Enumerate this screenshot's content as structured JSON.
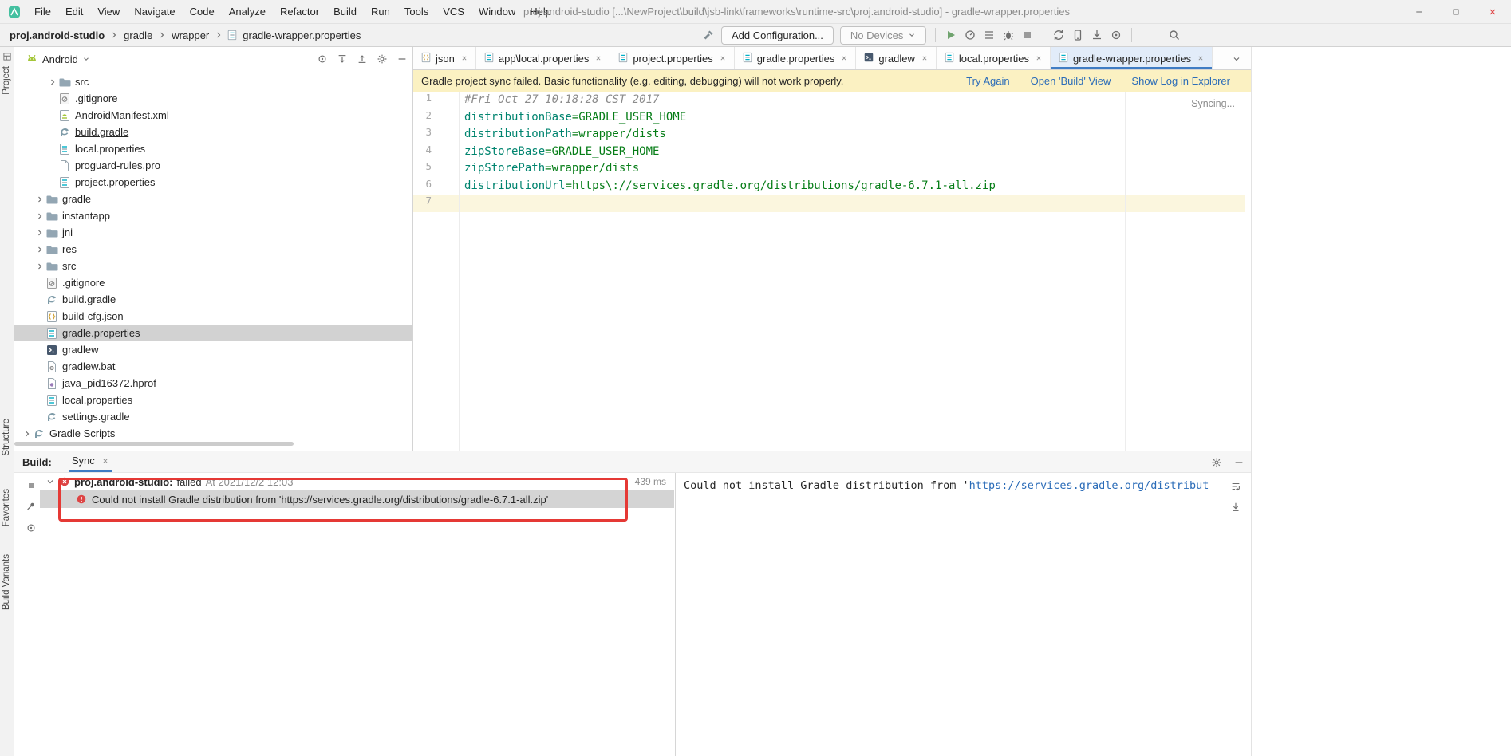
{
  "window": {
    "title": "proj.android-studio [...\\NewProject\\build\\jsb-link\\frameworks\\runtime-src\\proj.android-studio] - gradle-wrapper.properties",
    "menus": [
      "File",
      "Edit",
      "View",
      "Navigate",
      "Code",
      "Analyze",
      "Refactor",
      "Build",
      "Run",
      "Tools",
      "VCS",
      "Window",
      "Help"
    ]
  },
  "toolbar": {
    "breadcrumbs": [
      "proj.android-studio",
      "gradle",
      "wrapper",
      "gradle-wrapper.properties"
    ],
    "add_configuration": "Add Configuration...",
    "device_selector": "No Devices"
  },
  "stripes": {
    "project": "Project",
    "structure": "Structure",
    "favorites": "Favorites",
    "build_variants": "Build Variants"
  },
  "project_panel": {
    "selector": "Android",
    "tree": [
      {
        "label": "src"
      },
      {
        "label": ".gitignore"
      },
      {
        "label": "AndroidManifest.xml"
      },
      {
        "label": "build.gradle"
      },
      {
        "label": "local.properties"
      },
      {
        "label": "proguard-rules.pro"
      },
      {
        "label": "project.properties"
      },
      {
        "label": "gradle"
      },
      {
        "label": "instantapp"
      },
      {
        "label": "jni"
      },
      {
        "label": "res"
      },
      {
        "label": "src"
      },
      {
        "label": ".gitignore"
      },
      {
        "label": "build.gradle"
      },
      {
        "label": "build-cfg.json"
      },
      {
        "label": "gradle.properties"
      },
      {
        "label": "gradlew"
      },
      {
        "label": "gradlew.bat"
      },
      {
        "label": "java_pid16372.hprof"
      },
      {
        "label": "local.properties"
      },
      {
        "label": "settings.gradle"
      },
      {
        "label": "Gradle Scripts"
      }
    ]
  },
  "editor": {
    "tabs": [
      {
        "label": "json"
      },
      {
        "label": "app\\local.properties"
      },
      {
        "label": "project.properties"
      },
      {
        "label": "gradle.properties"
      },
      {
        "label": "gradlew"
      },
      {
        "label": "local.properties"
      },
      {
        "label": "gradle-wrapper.properties"
      }
    ],
    "banner": {
      "message": "Gradle project sync failed. Basic functionality (e.g. editing, debugging) will not work properly.",
      "actions": [
        "Try Again",
        "Open 'Build' View",
        "Show Log in Explorer"
      ]
    },
    "syncing": "Syncing...",
    "lines": [
      {
        "num": "1",
        "comment": "#Fri Oct 27 10:18:28 CST 2017"
      },
      {
        "num": "2",
        "key": "distributionBase",
        "rest": "=GRADLE_USER_HOME"
      },
      {
        "num": "3",
        "key": "distributionPath",
        "rest": "=wrapper/dists"
      },
      {
        "num": "4",
        "key": "zipStoreBase",
        "rest": "=GRADLE_USER_HOME"
      },
      {
        "num": "5",
        "key": "zipStorePath",
        "rest": "=wrapper/dists"
      },
      {
        "num": "6",
        "key": "distributionUrl",
        "rest": "=https\\://services.gradle.org/distributions/gradle-6.7.1-all.zip"
      },
      {
        "num": "7"
      }
    ]
  },
  "build_panel": {
    "label": "Build:",
    "tab": "Sync",
    "root_title": "proj.android-studio:",
    "root_status": "failed",
    "root_time": "At 2021/12/2 12:03",
    "duration": "439 ms",
    "error": "Could not install Gradle distribution from 'https://services.gradle.org/distributions/gradle-6.7.1-all.zip'",
    "console": {
      "text": "Could not install Gradle distribution from '",
      "link": "https://services.gradle.org/distribut"
    }
  },
  "colors": {
    "accent_blue": "#3f7cc4",
    "link_blue": "#2b6cb8",
    "error_red": "#e53935",
    "banner_yellow": "#fbf1c2",
    "selection_gray": "#d4d4d4"
  }
}
